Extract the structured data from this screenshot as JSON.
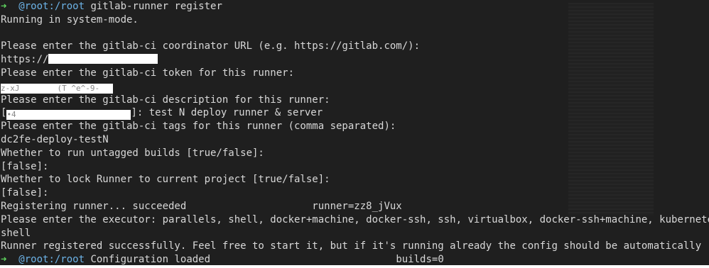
{
  "terminal": {
    "prompt_arrow": "➜",
    "prompt_path": "@root:/root",
    "lines": {
      "cmd1": "gitlab-runner register",
      "l1": "Running in system-mode.",
      "l3": "Please enter the gitlab-ci coordinator URL (e.g. https://gitlab.com/):",
      "l4_prefix": "https://",
      "l5": "Please enter the gitlab-ci token for this runner:",
      "l6_redacted_visible": "z-xJ        (T ^e^-9-",
      "l7": "Please enter the gitlab-ci description for this runner:",
      "l8_prefix": "[",
      "l8_redacted_visible": "•4",
      "l8_suffix": "]: test N deploy runner & server",
      "l9": "Please enter the gitlab-ci tags for this runner (comma separated):",
      "l10": "dc2fe-deploy-testN",
      "l11": "Whether to run untagged builds [true/false]:",
      "l12": "[false]:",
      "l13": "Whether to lock Runner to current project [true/false]:",
      "l14": "[false]:",
      "l15": "Registering runner... succeeded                     runner=zz8_jVux",
      "l16": "Please enter the executor: parallels, shell, docker+machine, docker-ssh, ssh, virtualbox, docker-ssh+machine, kubernetes, docker:",
      "l17": "shell",
      "l18": "Runner registered successfully. Feel free to start it, but if it's running already the config should be automatically reloaded!",
      "cmd2": "Configuration loaded                               builds=0"
    }
  },
  "colors": {
    "background": "#1f1f1f",
    "text": "#d8d8d8",
    "prompt_arrow": "#5fd75f",
    "prompt_path": "#6cb2e6"
  }
}
